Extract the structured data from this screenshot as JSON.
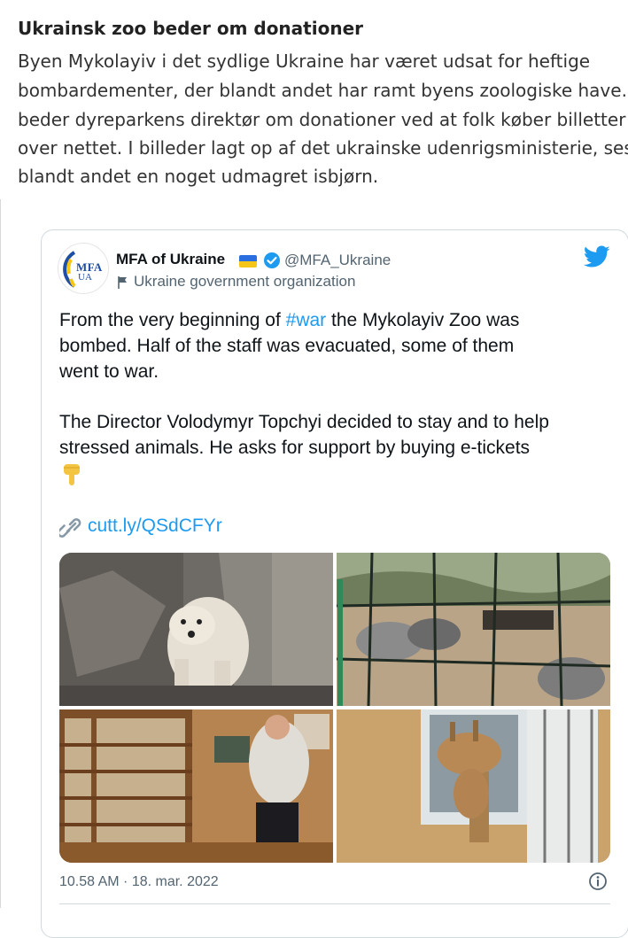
{
  "article": {
    "headline": "Ukrainsk zoo beder om donationer",
    "body_lines": [
      "Byen Mykolayiv i det sydlige Ukraine har været udsat for heftige",
      "bombardementer, der blandt andet har ramt byens zoologiske have. N",
      "beder dyreparkens direktør om donationer ved at folk køber billetter",
      "over nettet. I billeder lagt op af det ukrainske udenrigsministerie, ses",
      "blandt andet en noget udmagret isbjørn."
    ]
  },
  "tweet": {
    "avatar_text": "MFA",
    "avatar_subtext": "UA",
    "account_name": "MFA of Ukraine",
    "handle": "@MFA_Ukraine",
    "org_label": "Ukraine government organization",
    "line1_pre": "From the very beginning of ",
    "hashtag": "#war",
    "line1_post": " the Mykolayiv Zoo was",
    "line2": "bombed. Half of the staff was evacuated, some of them",
    "line3": "went to war.",
    "line4": "The Director Volodymyr Topchyi decided to stay and to help",
    "line5": "stressed animals. He asks for support by buying e-tickets",
    "link": "cutt.ly/QSdCFYr",
    "timestamp": "10.58 AM · 18. mar. 2022"
  },
  "media": [
    {
      "subject": "polar bear"
    },
    {
      "subject": "bombed enclosure behind fence"
    },
    {
      "subject": "zoo director in museum room"
    },
    {
      "subject": "giraffe at window"
    }
  ],
  "icons": {
    "flag": "ukraine-flag-icon",
    "verified": "verified-badge-icon",
    "org": "flag-outline-icon",
    "twitter": "twitter-bird-icon",
    "pointing": "pointing-down-hand-icon",
    "link": "link-icon",
    "info": "info-icon"
  },
  "colors": {
    "link_blue": "#1d9bf0",
    "name_text": "#0f1419",
    "muted_text": "#536471",
    "card_border": "#cfd9de",
    "flag_blue": "#2a6ee0",
    "flag_yellow": "#f5c518"
  }
}
